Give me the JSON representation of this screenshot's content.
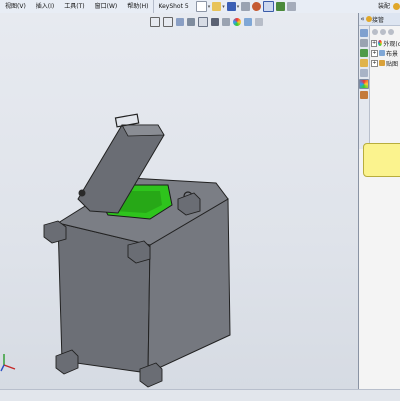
{
  "menu": {
    "items": [
      "视图(V)",
      "插入(I)",
      "工具(T)",
      "窗口(W)",
      "帮助(H)",
      "KeyShot 5"
    ]
  },
  "toolbar": {
    "icons": [
      "new-document-icon",
      "open-folder-icon",
      "save-icon",
      "print-icon",
      "undo-icon",
      "select-pointer-icon",
      "rebuild-icon",
      "options-icon"
    ]
  },
  "tab_right": {
    "label": "装配"
  },
  "taskpane": {
    "header": "接管",
    "collapse": "«",
    "tree": [
      {
        "label": "外观(c"
      },
      {
        "label": "布景"
      },
      {
        "label": "贴图"
      }
    ]
  },
  "colors": {
    "opening_green": "#2ec41c",
    "body_gray": "#6c6f76",
    "note_yellow": "#fbf38e"
  }
}
